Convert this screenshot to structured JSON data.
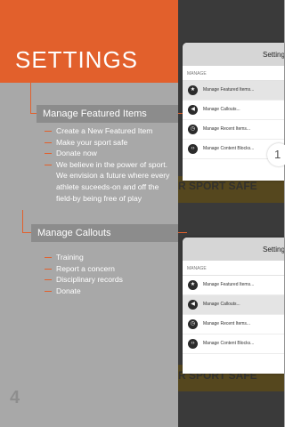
{
  "header": {
    "title": "SETTINGS"
  },
  "section1": {
    "label": "Manage Featured Items",
    "bullets": [
      "Create a New Featured Item",
      "Make your sport safe",
      "Donate now",
      "We believe in the power of sport. We envision a future where every athlete suceeds-on and off the field-by being free of play"
    ]
  },
  "section2": {
    "label": "Manage Callouts",
    "bullets": [
      "Training",
      "Report a concern",
      "Disciplinary records",
      "Donate"
    ]
  },
  "panel_top": {
    "title": "Setting",
    "section": "MANAGE",
    "items": [
      "Manage Featured Items...",
      "Manage Callouts...",
      "Manage Recent Items...",
      "Manage Content Blocks..."
    ]
  },
  "panel_bottom": {
    "title": "Setting",
    "section": "MANAGE",
    "items": [
      "Manage Featured Items...",
      "Manage Callouts...",
      "Manage Recent Items...",
      "Manage Content Blocks..."
    ]
  },
  "badge": "1",
  "background_text": "R SPORT SAFE",
  "page_number": "4",
  "colors": {
    "accent": "#e2602c",
    "background": "#a8a8a8",
    "label_box": "#8c8c8c"
  }
}
